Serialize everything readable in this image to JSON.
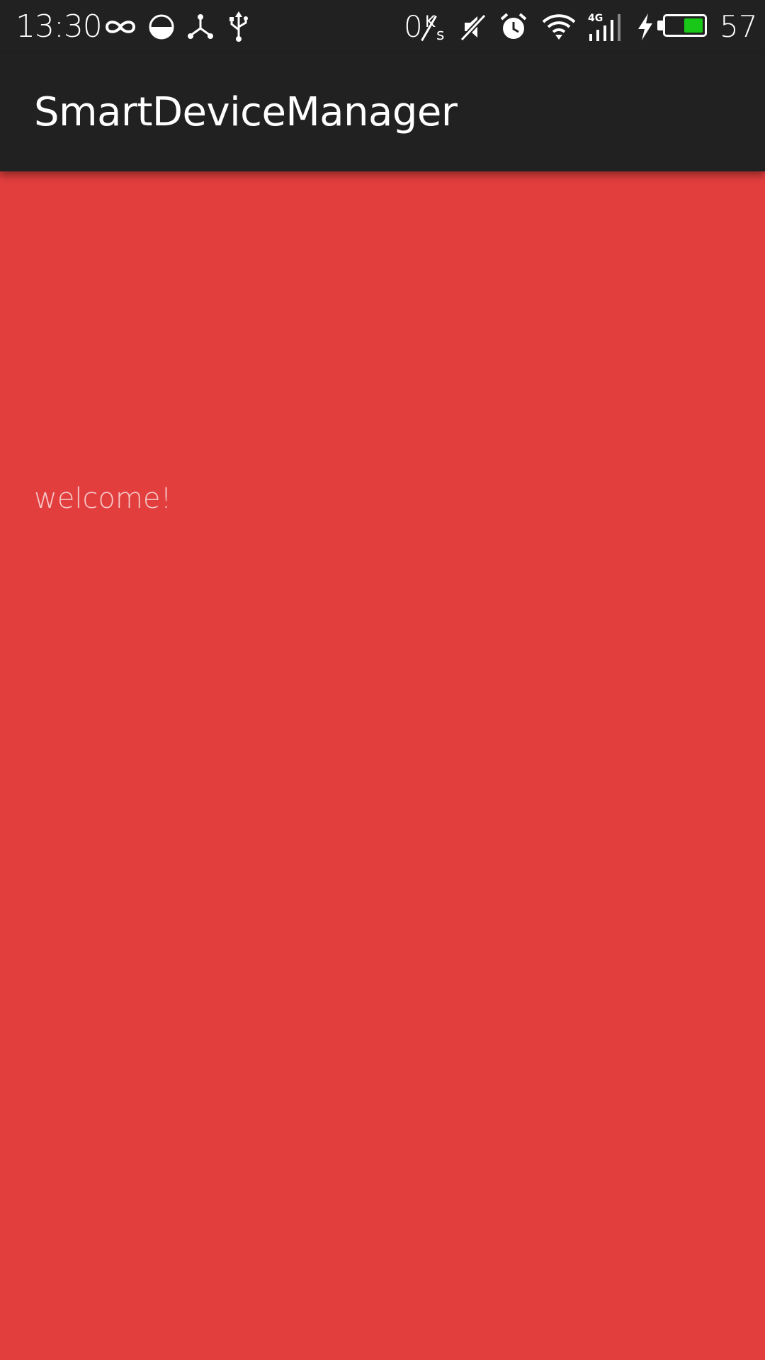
{
  "status_bar": {
    "time": "13:30",
    "net_speed": "0",
    "net_speed_unit_top": "K",
    "net_speed_unit_bottom": "s",
    "network_type": "4G",
    "battery_level": "57",
    "battery_fraction": 0.57,
    "icons": [
      "infinity-icon",
      "half-circle-icon",
      "share-hub-icon",
      "usb-icon",
      "mute-icon",
      "alarm-icon",
      "wifi-icon",
      "signal-icon",
      "charging-icon",
      "battery-icon"
    ]
  },
  "app_bar": {
    "title": "SmartDeviceManager"
  },
  "main": {
    "welcome_text": "welcome!"
  },
  "colors": {
    "status_bar_bg": "#212121",
    "app_bar_bg": "#212121",
    "content_bg": "#e23e3e",
    "welcome_text": "#f6c6c6",
    "battery_fill": "#18c718"
  }
}
